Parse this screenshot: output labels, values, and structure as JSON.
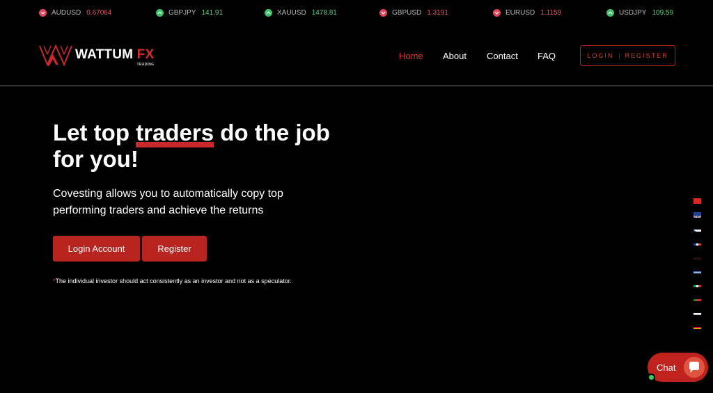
{
  "ticker": [
    {
      "symbol": "AUDUSD",
      "value": "0.67064",
      "direction": "down"
    },
    {
      "symbol": "GBPJPY",
      "value": "141.91",
      "direction": "up"
    },
    {
      "symbol": "XAUUSD",
      "value": "1478.81",
      "direction": "up"
    },
    {
      "symbol": "GBPUSD",
      "value": "1.3191",
      "direction": "down"
    },
    {
      "symbol": "EURUSD",
      "value": "1.1159",
      "direction": "down"
    },
    {
      "symbol": "USDJPY",
      "value": "109.59",
      "direction": "up"
    }
  ],
  "logo": {
    "word": "WATTUM",
    "accent": "FX",
    "sub": "TRADING"
  },
  "nav": {
    "home": "Home",
    "about": "About",
    "contact": "Contact",
    "faq": "FAQ"
  },
  "auth": {
    "login": "LOGIN",
    "sep": "|",
    "register": "REGISTER"
  },
  "hero": {
    "title_before": "Let top ",
    "title_highlight": "traders",
    "title_after": " do the job for you!",
    "subtitle": "Covesting allows you to automatically copy top performing traders and achieve the returns",
    "login_button": "Login Account",
    "register_button": "Register",
    "note_star": "*",
    "note": "The individual investor should act consistently as an investor and not as a speculator."
  },
  "languages": [
    "chinese",
    "english",
    "czech",
    "french",
    "german",
    "greek",
    "italian",
    "portuguese",
    "russian",
    "spanish"
  ],
  "chat": {
    "label": "Chat"
  },
  "colors": {
    "accent": "#c0221e",
    "up": "#3fbf6b",
    "down": "#e0485f",
    "background": "#000000"
  }
}
